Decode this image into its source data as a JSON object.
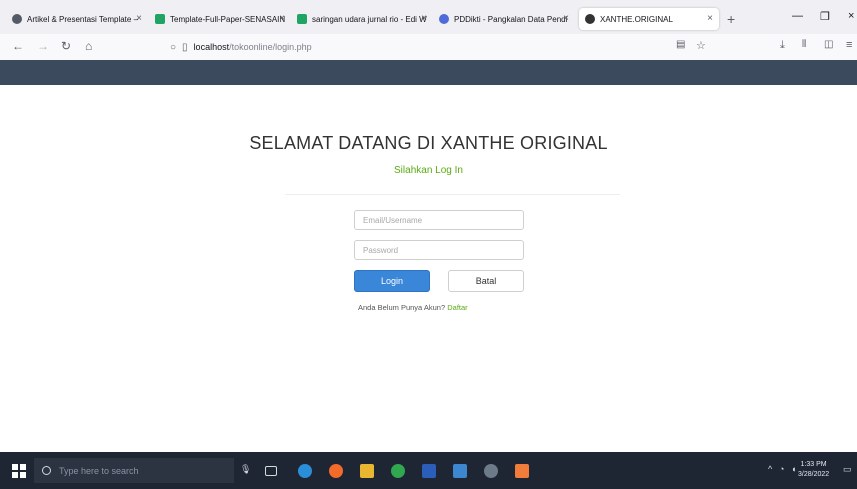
{
  "browser": {
    "tabs": [
      {
        "label": "Artikel & Presentasi Template –",
        "icon": "page-icon",
        "color": "#555b66"
      },
      {
        "label": "Template-Full-Paper-SENASAIN",
        "icon": "google-drive-icon",
        "color": "#1fa463"
      },
      {
        "label": "saringan udara jurnal rio - Edi W",
        "icon": "google-drive-icon",
        "color": "#1fa463"
      },
      {
        "label": "PDDikti - Pangkalan Data Pendi",
        "icon": "globe-icon",
        "color": "#4f6bd8"
      },
      {
        "label": "XANTHE.ORIGINAL",
        "icon": "page-icon",
        "color": "#333333",
        "active": true
      }
    ],
    "url_host": "localhost",
    "url_path": "/tokoonline/login.php"
  },
  "login": {
    "title": "SELAMAT DATANG DI XANTHE ORIGINAL",
    "subtitle": "Silahkan Log In",
    "email_placeholder": "Email/Username",
    "password_placeholder": "Password",
    "login_label": "Login",
    "cancel_label": "Batal",
    "register_prompt": "Anda Belum Punya Akun?",
    "register_link": "Daftar"
  },
  "taskbar": {
    "search_placeholder": "Type here to search",
    "time": "1:33 PM",
    "date": "3/28/2022"
  },
  "colors": {
    "header_bar": "#3b4a5c",
    "accent_green": "#5aaa12",
    "login_button": "#3a86d8"
  }
}
